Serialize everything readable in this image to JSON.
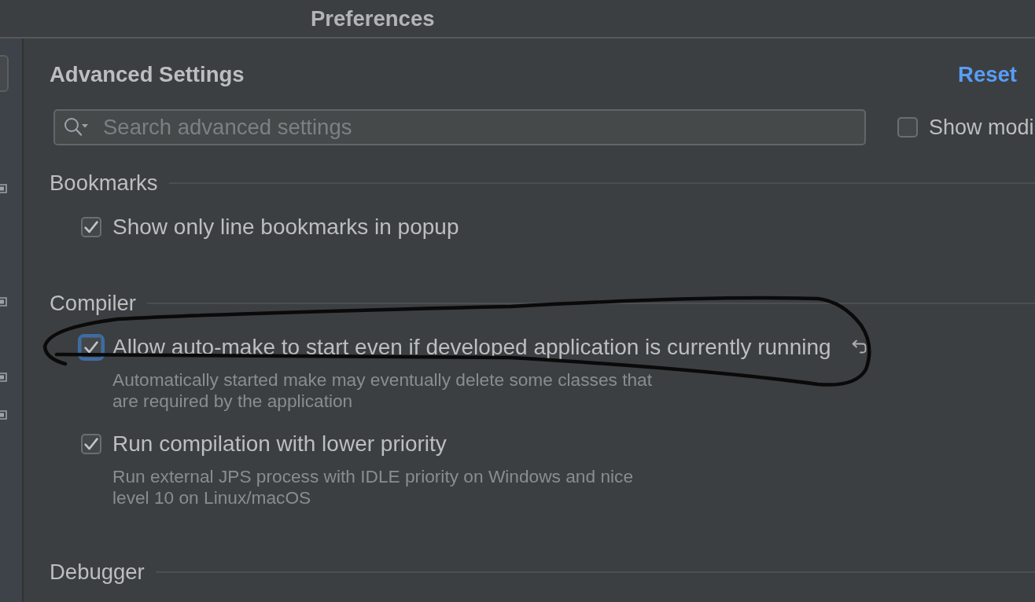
{
  "window": {
    "title": "Preferences"
  },
  "header": {
    "title": "Advanced Settings",
    "reset_link": "Reset"
  },
  "search": {
    "placeholder": "Search advanced settings"
  },
  "show_modified": {
    "label": "Show modi",
    "checked": false
  },
  "sections": [
    {
      "title": "Bookmarks",
      "options": [
        {
          "label": "Show only line bookmarks in popup",
          "checked": true,
          "focused": false,
          "modified": false
        }
      ]
    },
    {
      "title": "Compiler",
      "options": [
        {
          "label": "Allow auto-make to start even if developed application is currently running",
          "checked": true,
          "focused": true,
          "modified": true,
          "description": "Automatically started make may eventually delete some classes that are required by the application"
        },
        {
          "label": "Run compilation with lower priority",
          "checked": true,
          "focused": false,
          "modified": false,
          "description": "Run external JPS process with IDLE priority on Windows and nice level 10 on Linux/macOS"
        }
      ]
    },
    {
      "title": "Debugger"
    }
  ]
}
